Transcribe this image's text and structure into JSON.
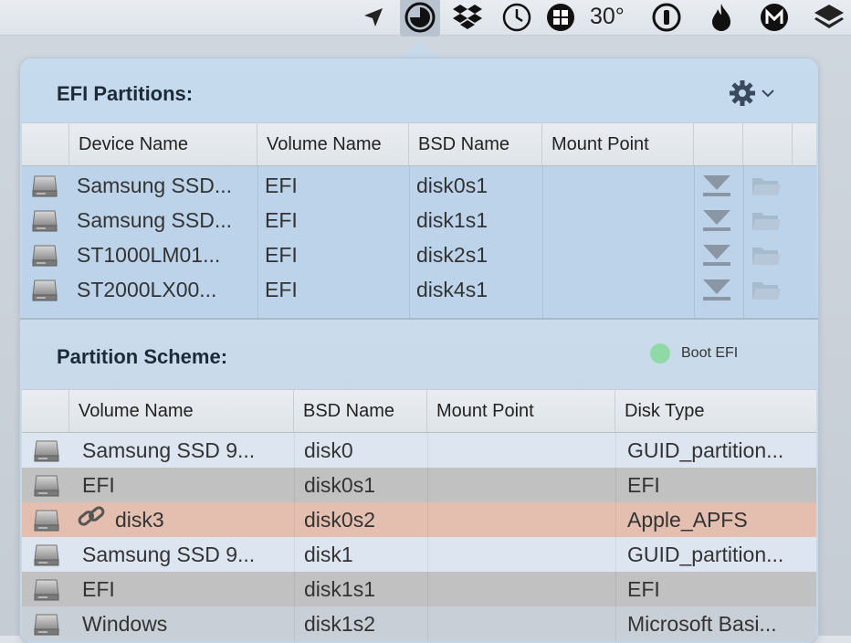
{
  "menubar": {
    "temperature": "30°",
    "icons": [
      "location-arrow-icon",
      "clock-pie-icon",
      "dropbox-icon",
      "clock-icon",
      "grid-icon",
      "one-password-icon",
      "flame-icon",
      "m-icon",
      "layers-icon"
    ]
  },
  "efi": {
    "title": "EFI Partitions:",
    "columns": [
      "Device Name",
      "Volume Name",
      "BSD Name",
      "Mount Point"
    ],
    "rows": [
      {
        "device": "Samsung SSD...",
        "volume": "EFI",
        "bsd": "disk0s1",
        "mount": ""
      },
      {
        "device": "Samsung SSD...",
        "volume": "EFI",
        "bsd": "disk1s1",
        "mount": ""
      },
      {
        "device": "ST1000LM01...",
        "volume": "EFI",
        "bsd": "disk2s1",
        "mount": ""
      },
      {
        "device": "ST2000LX00...",
        "volume": "EFI",
        "bsd": "disk4s1",
        "mount": ""
      }
    ]
  },
  "scheme": {
    "title": "Partition Scheme:",
    "legend": "Boot EFI",
    "legend_color": "#8fd9a7",
    "columns": [
      "Volume Name",
      "BSD Name",
      "Mount Point",
      "Disk Type"
    ],
    "rows": [
      {
        "volume": "Samsung SSD 9...",
        "bsd": "disk0",
        "mount": "",
        "type": "GUID_partition...",
        "bg": "#dde6f0"
      },
      {
        "volume": "EFI",
        "bsd": "disk0s1",
        "mount": "",
        "type": "EFI",
        "bg": "#c2c1c2"
      },
      {
        "volume": "disk3",
        "bsd": "disk0s2",
        "mount": "",
        "type": "Apple_APFS",
        "bg": "#e4bfb0",
        "link": true
      },
      {
        "volume": "Samsung SSD 9...",
        "bsd": "disk1",
        "mount": "",
        "type": "GUID_partition...",
        "bg": "#dde6f0"
      },
      {
        "volume": "EFI",
        "bsd": "disk1s1",
        "mount": "",
        "type": "EFI",
        "bg": "#c2c1c2"
      },
      {
        "volume": "Windows",
        "bsd": "disk1s2",
        "mount": "",
        "type": "Microsoft Basi...",
        "bg": "#c9cfd6"
      }
    ]
  }
}
